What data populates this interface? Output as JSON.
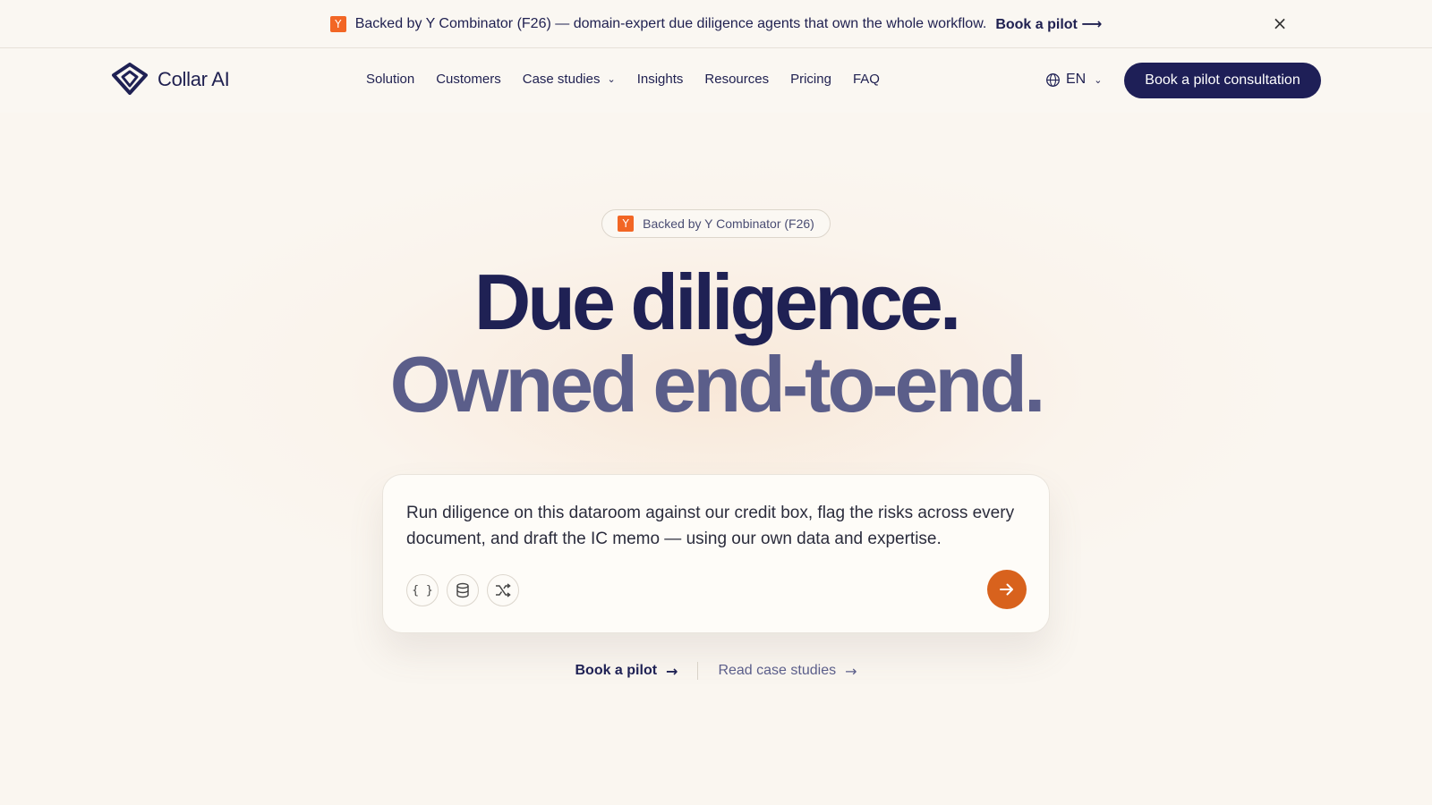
{
  "announcement": {
    "badge": "Y",
    "text": "Backed by Y Combinator (F26) — domain-expert due diligence agents that own the whole workflow.",
    "cta": "Book a pilot ⟶",
    "close_icon": "×"
  },
  "nav": {
    "brand": "Collar AI",
    "items": [
      {
        "label": "Solution"
      },
      {
        "label": "Customers"
      },
      {
        "label": "Case studies",
        "has_dropdown": true
      },
      {
        "label": "Insights"
      },
      {
        "label": "Resources"
      },
      {
        "label": "Pricing"
      },
      {
        "label": "FAQ"
      }
    ],
    "language": "EN",
    "cta": "Book a pilot consultation"
  },
  "hero": {
    "pill_badge": "Y",
    "pill_text": "Backed by Y Combinator (F26)",
    "headline_1": "Due diligence.",
    "headline_2": "Owned end-to-end.",
    "prompt_text": "Run diligence on this dataroom against our credit box, flag the risks across every document, and draft the IC memo — using our own data and expertise.",
    "tools": [
      "braces-icon",
      "database-icon",
      "shuffle-icon"
    ],
    "link_primary": "Book a pilot",
    "link_secondary": "Read case studies"
  },
  "colors": {
    "background": "#faf6f0",
    "navy": "#1e1f57",
    "headline_secondary": "#5b5e8a",
    "accent_orange": "#d8621d",
    "yc_orange": "#f26625"
  }
}
